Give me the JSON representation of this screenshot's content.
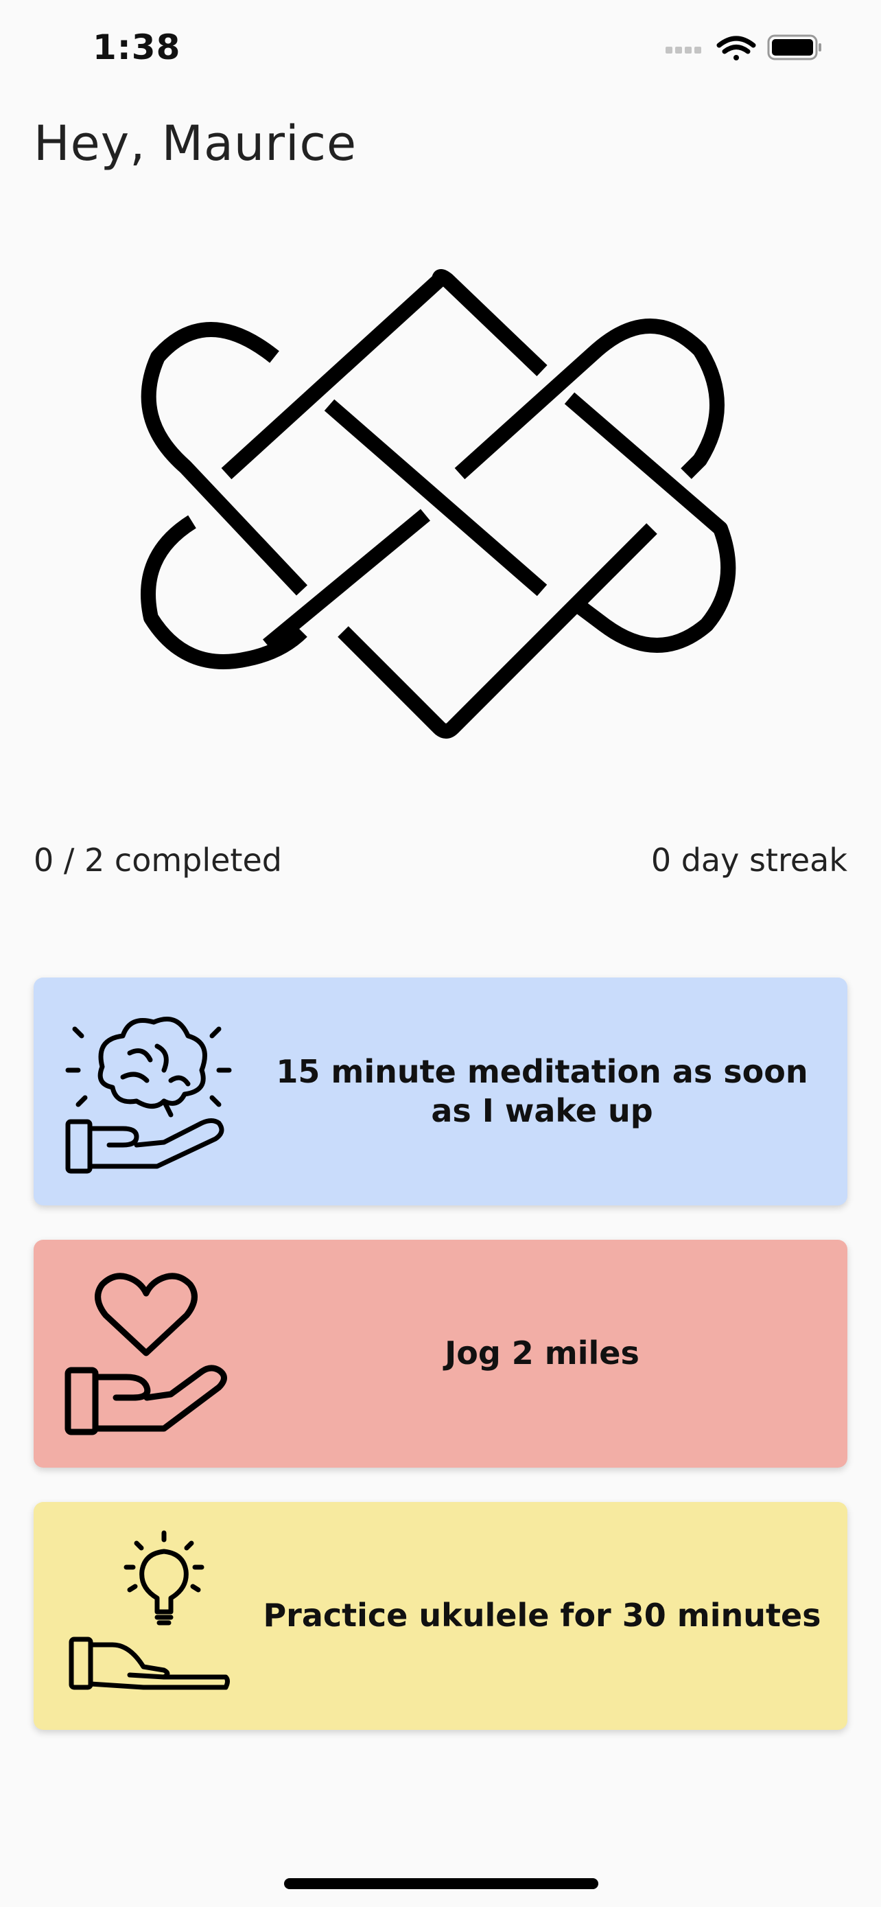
{
  "status_bar": {
    "time": "1:38",
    "icons": [
      "cellular-signal-icon",
      "wifi-icon",
      "battery-icon"
    ]
  },
  "header": {
    "greeting": "Hey, Maurice"
  },
  "logo": {
    "icon": "interwoven-knot-logo"
  },
  "stats": {
    "completed": "0 / 2 completed",
    "streak": "0 day streak"
  },
  "habits": [
    {
      "label": "15 minute meditation as soon as I wake up",
      "color": "#c9dcfb",
      "icon": "brain-in-hand-icon"
    },
    {
      "label": "Jog 2 miles",
      "color": "#f2aea6",
      "icon": "heart-in-hand-icon"
    },
    {
      "label": "Practice ukulele for 30 minutes",
      "color": "#f7ea9f",
      "icon": "lightbulb-in-hand-icon"
    }
  ]
}
